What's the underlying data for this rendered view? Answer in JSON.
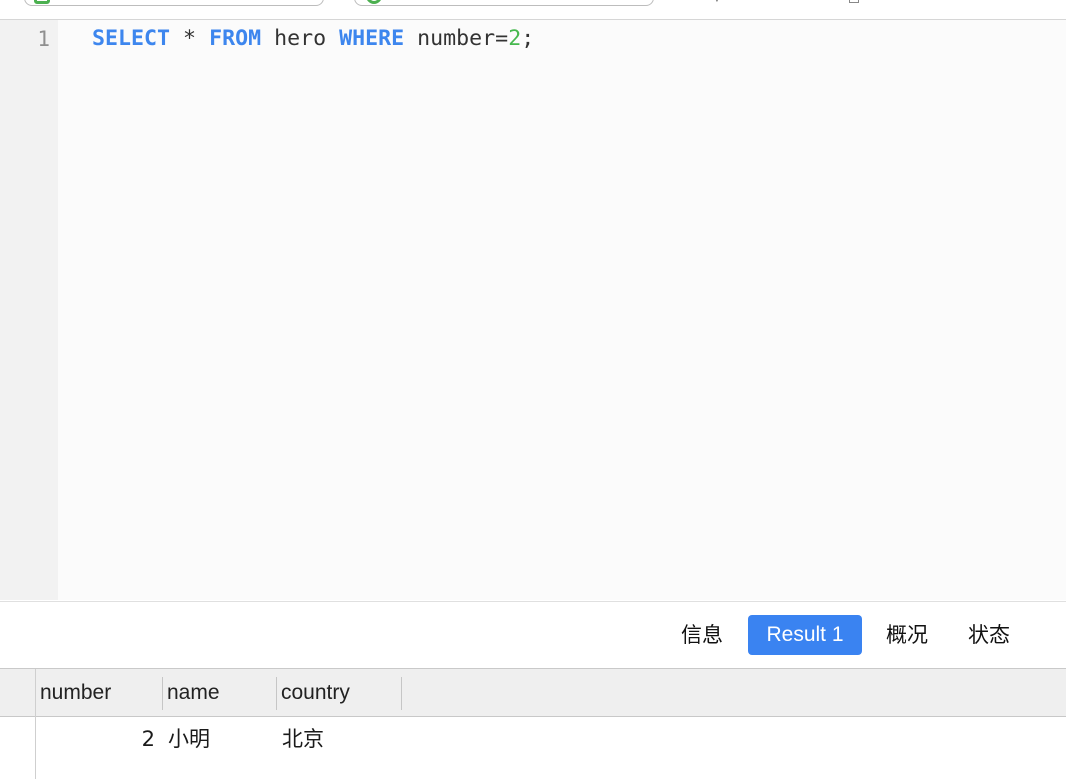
{
  "editor": {
    "line_number": "1",
    "sql": {
      "kw_select": "SELECT",
      "star": "*",
      "kw_from": "FROM",
      "table": "hero",
      "kw_where": "WHERE",
      "column": "number",
      "op": "=",
      "value": "2",
      "terminator": ";"
    }
  },
  "tabs": {
    "info": "信息",
    "result": "Result 1",
    "overview": "概况",
    "status": "状态",
    "active": "Result 1"
  },
  "results": {
    "columns": [
      "number",
      "name",
      "country"
    ],
    "rows": [
      {
        "number": "2",
        "name": "小明",
        "country": "北京"
      }
    ]
  },
  "colors": {
    "keyword": "#3d86ee",
    "numeric_literal": "#46b84e",
    "active_tab": "#3a83f1"
  }
}
